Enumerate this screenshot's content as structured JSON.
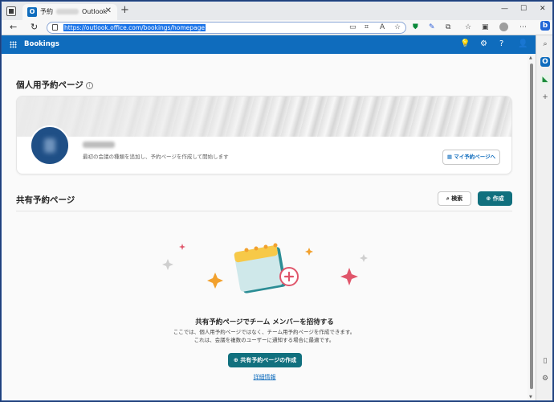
{
  "browser": {
    "tab": {
      "title_prefix": "予約",
      "title_suffix": "Outlook",
      "favicon_letter": "O"
    },
    "new_tab_label": "+",
    "url": "https://outlook.office.com/bookings/homepage",
    "window_controls": {
      "minimize": "—",
      "maximize": "☐",
      "close": "✕"
    }
  },
  "app": {
    "name": "Bookings"
  },
  "personal": {
    "section_title": "個人用予約ページ",
    "description": "最初の会議の種類を追加し、予約ページを作成して開始します",
    "my_page_button": "マイ予約ページへ"
  },
  "shared": {
    "section_title": "共有予約ページ",
    "search_button": "検索",
    "create_button": "作成",
    "empty_title": "共有予約ページでチーム メンバーを招待する",
    "empty_description": "ここでは、個人用予約ページではなく、チーム用予約ページを作成できます。これは、会議を複数のユーザーに通知する場合に最適です。",
    "create_shared_button": "共有予約ページの作成",
    "learn_more": "詳細情報"
  },
  "colors": {
    "header_blue": "#0f6cbd",
    "teal_button": "#11707e",
    "sparkle_orange": "#f2a12e",
    "sparkle_pink": "#e0566b",
    "calendar_teal": "#cfe8ea"
  },
  "icons": {
    "header": [
      "lightbulb-icon",
      "settings-icon",
      "help-icon",
      "person-icon"
    ],
    "sidebar": [
      "bing-icon",
      "search-icon",
      "outlook-icon",
      "bookings-icon",
      "add-icon",
      "panel-icon",
      "settings-icon"
    ]
  }
}
